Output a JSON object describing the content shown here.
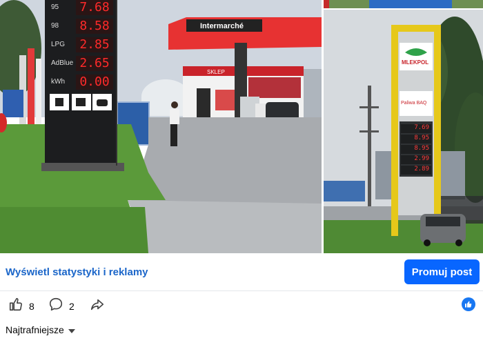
{
  "photos": {
    "left": {
      "station_brand": "Intermarché",
      "shop_sign": "SKLEP",
      "price_rows": [
        {
          "label": "95",
          "price": "7.68"
        },
        {
          "label": "98",
          "price": "8.58"
        },
        {
          "label": "LPG",
          "price": "2.85"
        },
        {
          "label": "AdBlue",
          "price": "2.65"
        },
        {
          "label": "kWh",
          "price": "0.00"
        }
      ]
    },
    "right": {
      "brand_top": "MLEKPOL",
      "brand_sub": "Paliwa BAQ",
      "prices": [
        "7.69",
        "8.95",
        "8.95",
        "2.99",
        "2.89"
      ]
    }
  },
  "actions": {
    "stats_link": "Wyświetl statystyki i reklamy",
    "promote_button": "Promuj post"
  },
  "reactions": {
    "likes": "8",
    "comments": "2"
  },
  "sort": {
    "label": "Najtrafniejsze"
  },
  "colors": {
    "accent": "#0866ff",
    "link": "#1b66c9",
    "price_red": "#ff2a2a",
    "pylon_yellow": "#e6c81a"
  }
}
